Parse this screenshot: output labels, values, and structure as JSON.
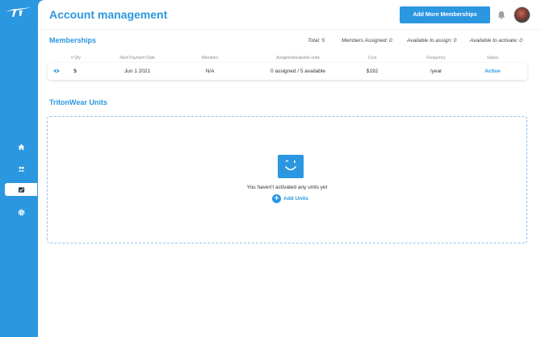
{
  "header": {
    "title": "Account management",
    "add_button": "Add More Memberships"
  },
  "memberships": {
    "title": "Memberships",
    "summary": {
      "total": "Total: 5",
      "assigned": "Members Assigned: 0",
      "available_assign": "Available to assign: 0",
      "available_activate": "Available to activate: 0"
    },
    "columns": [
      "# Qty",
      "Next Payment Date",
      "Members",
      "Assigned/available units",
      "Cost",
      "Frequency",
      "Status"
    ],
    "rows": [
      {
        "qty": "5",
        "next_payment": "Jun 1 2021",
        "members": "N/A",
        "units": "0 assigned / 5 available",
        "cost": "$192",
        "frequency": "/year",
        "status": "Active"
      }
    ]
  },
  "units": {
    "title": "TritonWear Units",
    "empty_text": "You haven't activated any units yet",
    "add_label": "Add Units"
  },
  "colors": {
    "brand": "#2b97e0",
    "text": "#333333",
    "muted": "#8a8f95"
  },
  "icons": {
    "nav": [
      "home-icon",
      "people-icon",
      "billing-icon",
      "settings-icon"
    ],
    "header": [
      "bell-icon"
    ],
    "row": [
      "eye-icon"
    ]
  }
}
